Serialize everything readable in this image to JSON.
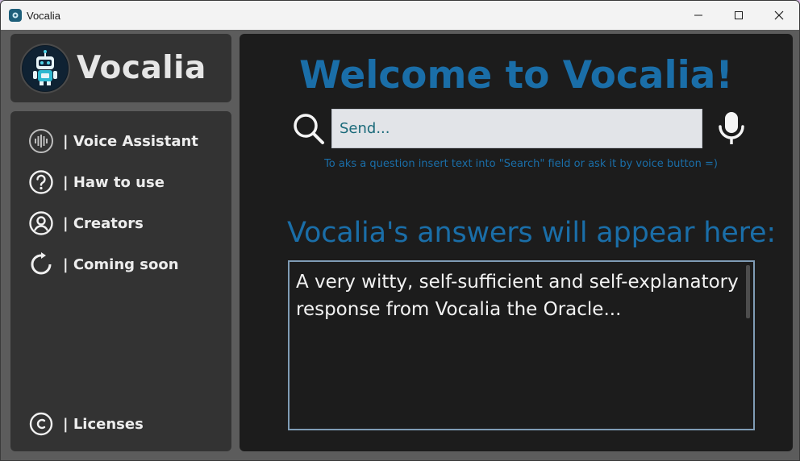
{
  "window": {
    "title": "Vocalia",
    "controls": [
      "minimize",
      "maximize",
      "close"
    ]
  },
  "sidebar": {
    "logo_text": "Vocalia",
    "items": [
      {
        "label": "| Voice Assistant",
        "icon": "waveform-icon"
      },
      {
        "label": "| Haw to use",
        "icon": "help-icon"
      },
      {
        "label": "| Creators",
        "icon": "user-icon"
      },
      {
        "label": "| Coming soon",
        "icon": "refresh-icon"
      }
    ],
    "footer_item": {
      "label": "| Licenses",
      "icon": "copyright-icon"
    }
  },
  "main": {
    "welcome": "Welcome to Vocalia!",
    "search": {
      "placeholder": "Send...",
      "value": ""
    },
    "hint": "To aks a question insert text into \"Search\" field or ask it by voice button =)",
    "answers_heading": "Vocalia's answers will appear here:",
    "answer_text": "A very witty, self-sufficient and self-explanatory response from Vocalia the Oracle..."
  },
  "colors": {
    "accent": "#1a6ea8",
    "panel": "#333333",
    "main_bg": "#1c1c1c",
    "frame_bg": "#5c5c5c"
  }
}
